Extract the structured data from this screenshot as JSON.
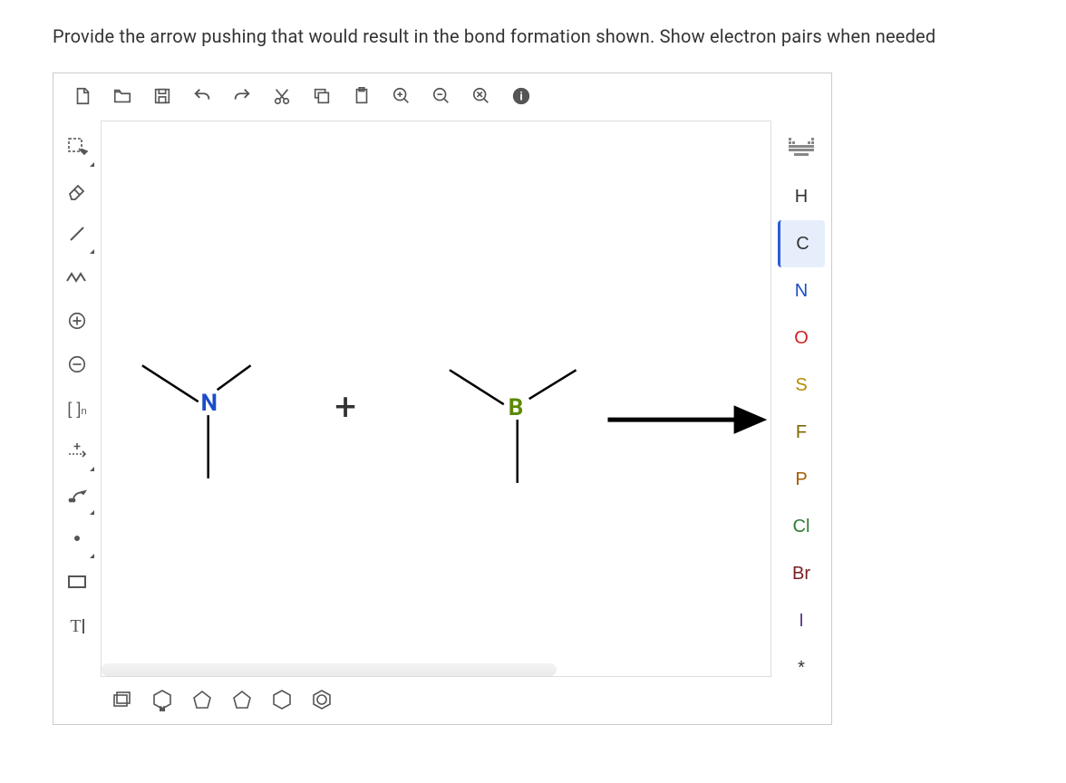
{
  "prompt": "Provide the arrow pushing that would result in the bond formation shown. Show electron pairs when needed",
  "topToolbar": [
    {
      "name": "new-doc",
      "icon": "new"
    },
    {
      "name": "open-doc",
      "icon": "open"
    },
    {
      "name": "save-doc",
      "icon": "save"
    },
    {
      "name": "undo",
      "icon": "undo"
    },
    {
      "name": "redo",
      "icon": "redo"
    },
    {
      "name": "cut",
      "icon": "cut"
    },
    {
      "name": "copy",
      "icon": "copy"
    },
    {
      "name": "paste",
      "icon": "paste"
    },
    {
      "name": "zoom-in",
      "icon": "zoom-in"
    },
    {
      "name": "zoom-out",
      "icon": "zoom-out"
    },
    {
      "name": "zoom-reset",
      "icon": "zoom-reset"
    },
    {
      "name": "info",
      "icon": "info"
    }
  ],
  "leftToolbar": [
    {
      "name": "selection-tool",
      "icon": "marquee",
      "corner": true
    },
    {
      "name": "erase-tool",
      "icon": "eraser"
    },
    {
      "name": "bond-tool",
      "icon": "single-bond",
      "corner": true
    },
    {
      "name": "chain-tool",
      "icon": "chain"
    },
    {
      "name": "charge-plus-tool",
      "icon": "circle-plus"
    },
    {
      "name": "charge-minus-tool",
      "icon": "circle-minus"
    },
    {
      "name": "bracket-tool",
      "icon": "bracket-n"
    },
    {
      "name": "reaction-plus-tool",
      "icon": "reaction-plus",
      "corner": true
    },
    {
      "name": "arrow-push-tool",
      "icon": "curved-arrow",
      "corner": true
    },
    {
      "name": "radical-tool",
      "icon": "radical",
      "corner": true
    },
    {
      "name": "shape-tool",
      "icon": "rect"
    },
    {
      "name": "text-tool",
      "icon": "text"
    }
  ],
  "rightToolbar": [
    {
      "name": "periodic-table",
      "icon": "ptable"
    },
    {
      "name": "elem-H",
      "label": "H",
      "class": "elem-H"
    },
    {
      "name": "elem-C",
      "label": "C",
      "class": "elem-C",
      "selected": true
    },
    {
      "name": "elem-N",
      "label": "N",
      "class": "elem-N"
    },
    {
      "name": "elem-O",
      "label": "O",
      "class": "elem-O"
    },
    {
      "name": "elem-S",
      "label": "S",
      "class": "elem-S"
    },
    {
      "name": "elem-F",
      "label": "F",
      "class": "elem-F"
    },
    {
      "name": "elem-P",
      "label": "P",
      "class": "elem-P"
    },
    {
      "name": "elem-Cl",
      "label": "Cl",
      "class": "elem-Cl"
    },
    {
      "name": "elem-Br",
      "label": "Br",
      "class": "elem-Br"
    },
    {
      "name": "elem-I",
      "label": "I",
      "class": "elem-I"
    },
    {
      "name": "elem-wildcard",
      "label": "*",
      "class": "elem-star"
    }
  ],
  "bottomToolbar": [
    {
      "name": "templates-button",
      "icon": "templates"
    },
    {
      "name": "pyridine-template",
      "icon": "pyridine"
    },
    {
      "name": "cyclopentadiene-template",
      "icon": "cyclopentadiene"
    },
    {
      "name": "pentagon-template",
      "icon": "pentagon"
    },
    {
      "name": "hexagon-template",
      "icon": "hexagon"
    },
    {
      "name": "benzene-template",
      "icon": "benzene"
    }
  ],
  "canvas": {
    "reactant1": {
      "center_label": "N"
    },
    "plus": "+",
    "reactant2": {
      "center_label": "B"
    }
  }
}
